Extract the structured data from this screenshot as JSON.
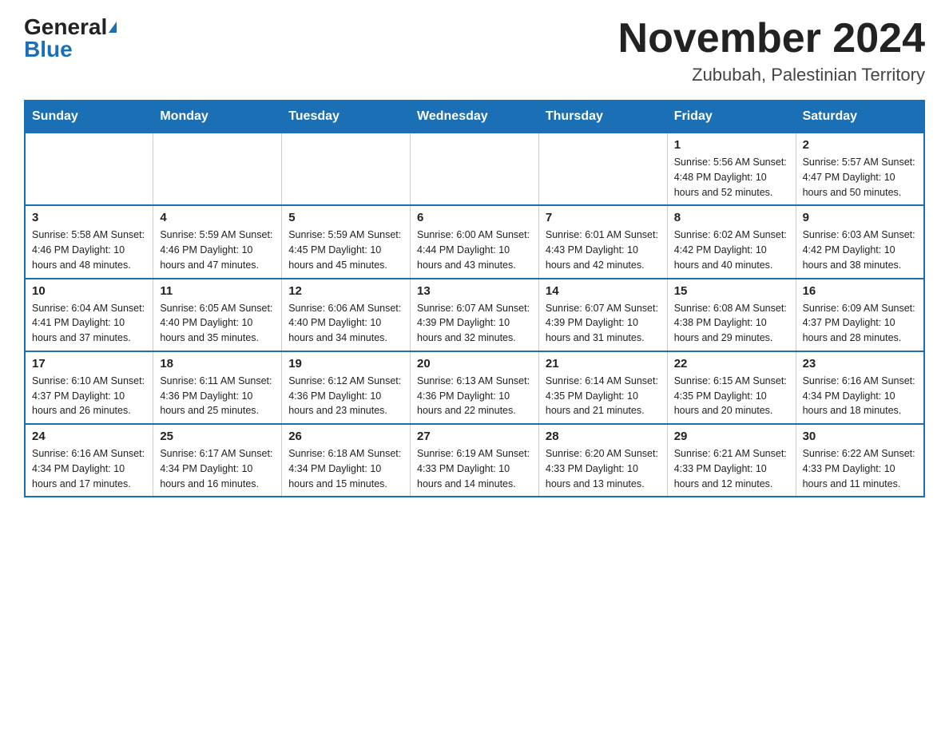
{
  "header": {
    "logo_general": "General",
    "logo_blue": "Blue",
    "month_title": "November 2024",
    "location": "Zububah, Palestinian Territory"
  },
  "weekdays": [
    "Sunday",
    "Monday",
    "Tuesday",
    "Wednesday",
    "Thursday",
    "Friday",
    "Saturday"
  ],
  "weeks": [
    [
      {
        "day": "",
        "info": ""
      },
      {
        "day": "",
        "info": ""
      },
      {
        "day": "",
        "info": ""
      },
      {
        "day": "",
        "info": ""
      },
      {
        "day": "",
        "info": ""
      },
      {
        "day": "1",
        "info": "Sunrise: 5:56 AM\nSunset: 4:48 PM\nDaylight: 10 hours and 52 minutes."
      },
      {
        "day": "2",
        "info": "Sunrise: 5:57 AM\nSunset: 4:47 PM\nDaylight: 10 hours and 50 minutes."
      }
    ],
    [
      {
        "day": "3",
        "info": "Sunrise: 5:58 AM\nSunset: 4:46 PM\nDaylight: 10 hours and 48 minutes."
      },
      {
        "day": "4",
        "info": "Sunrise: 5:59 AM\nSunset: 4:46 PM\nDaylight: 10 hours and 47 minutes."
      },
      {
        "day": "5",
        "info": "Sunrise: 5:59 AM\nSunset: 4:45 PM\nDaylight: 10 hours and 45 minutes."
      },
      {
        "day": "6",
        "info": "Sunrise: 6:00 AM\nSunset: 4:44 PM\nDaylight: 10 hours and 43 minutes."
      },
      {
        "day": "7",
        "info": "Sunrise: 6:01 AM\nSunset: 4:43 PM\nDaylight: 10 hours and 42 minutes."
      },
      {
        "day": "8",
        "info": "Sunrise: 6:02 AM\nSunset: 4:42 PM\nDaylight: 10 hours and 40 minutes."
      },
      {
        "day": "9",
        "info": "Sunrise: 6:03 AM\nSunset: 4:42 PM\nDaylight: 10 hours and 38 minutes."
      }
    ],
    [
      {
        "day": "10",
        "info": "Sunrise: 6:04 AM\nSunset: 4:41 PM\nDaylight: 10 hours and 37 minutes."
      },
      {
        "day": "11",
        "info": "Sunrise: 6:05 AM\nSunset: 4:40 PM\nDaylight: 10 hours and 35 minutes."
      },
      {
        "day": "12",
        "info": "Sunrise: 6:06 AM\nSunset: 4:40 PM\nDaylight: 10 hours and 34 minutes."
      },
      {
        "day": "13",
        "info": "Sunrise: 6:07 AM\nSunset: 4:39 PM\nDaylight: 10 hours and 32 minutes."
      },
      {
        "day": "14",
        "info": "Sunrise: 6:07 AM\nSunset: 4:39 PM\nDaylight: 10 hours and 31 minutes."
      },
      {
        "day": "15",
        "info": "Sunrise: 6:08 AM\nSunset: 4:38 PM\nDaylight: 10 hours and 29 minutes."
      },
      {
        "day": "16",
        "info": "Sunrise: 6:09 AM\nSunset: 4:37 PM\nDaylight: 10 hours and 28 minutes."
      }
    ],
    [
      {
        "day": "17",
        "info": "Sunrise: 6:10 AM\nSunset: 4:37 PM\nDaylight: 10 hours and 26 minutes."
      },
      {
        "day": "18",
        "info": "Sunrise: 6:11 AM\nSunset: 4:36 PM\nDaylight: 10 hours and 25 minutes."
      },
      {
        "day": "19",
        "info": "Sunrise: 6:12 AM\nSunset: 4:36 PM\nDaylight: 10 hours and 23 minutes."
      },
      {
        "day": "20",
        "info": "Sunrise: 6:13 AM\nSunset: 4:36 PM\nDaylight: 10 hours and 22 minutes."
      },
      {
        "day": "21",
        "info": "Sunrise: 6:14 AM\nSunset: 4:35 PM\nDaylight: 10 hours and 21 minutes."
      },
      {
        "day": "22",
        "info": "Sunrise: 6:15 AM\nSunset: 4:35 PM\nDaylight: 10 hours and 20 minutes."
      },
      {
        "day": "23",
        "info": "Sunrise: 6:16 AM\nSunset: 4:34 PM\nDaylight: 10 hours and 18 minutes."
      }
    ],
    [
      {
        "day": "24",
        "info": "Sunrise: 6:16 AM\nSunset: 4:34 PM\nDaylight: 10 hours and 17 minutes."
      },
      {
        "day": "25",
        "info": "Sunrise: 6:17 AM\nSunset: 4:34 PM\nDaylight: 10 hours and 16 minutes."
      },
      {
        "day": "26",
        "info": "Sunrise: 6:18 AM\nSunset: 4:34 PM\nDaylight: 10 hours and 15 minutes."
      },
      {
        "day": "27",
        "info": "Sunrise: 6:19 AM\nSunset: 4:33 PM\nDaylight: 10 hours and 14 minutes."
      },
      {
        "day": "28",
        "info": "Sunrise: 6:20 AM\nSunset: 4:33 PM\nDaylight: 10 hours and 13 minutes."
      },
      {
        "day": "29",
        "info": "Sunrise: 6:21 AM\nSunset: 4:33 PM\nDaylight: 10 hours and 12 minutes."
      },
      {
        "day": "30",
        "info": "Sunrise: 6:22 AM\nSunset: 4:33 PM\nDaylight: 10 hours and 11 minutes."
      }
    ]
  ]
}
